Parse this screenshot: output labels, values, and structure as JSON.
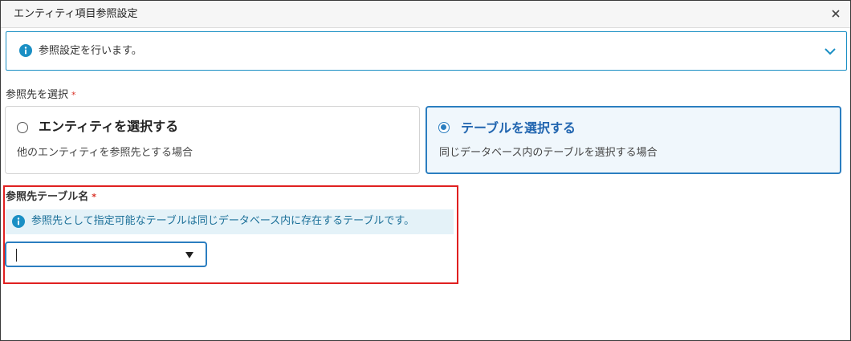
{
  "dialog": {
    "title": "エンティティ項目参照設定"
  },
  "banner": {
    "text": "参照設定を行います。"
  },
  "reference_target": {
    "label": "参照先を選択",
    "required_mark": "*",
    "options": [
      {
        "title": "エンティティを選択する",
        "description": "他のエンティティを参照先とする場合",
        "selected": false
      },
      {
        "title": "テーブルを選択する",
        "description": "同じデータベース内のテーブルを選択する場合",
        "selected": true
      }
    ]
  },
  "table_name": {
    "label": "参照先テーブル名",
    "required_mark": "*",
    "hint": "参照先として指定可能なテーブルは同じデータベース内に存在するテーブルです。",
    "select_value": ""
  },
  "colors": {
    "accent": "#2b7ec0",
    "info": "#1a8fc4",
    "required": "#d93025",
    "highlight_frame": "#e02020"
  }
}
